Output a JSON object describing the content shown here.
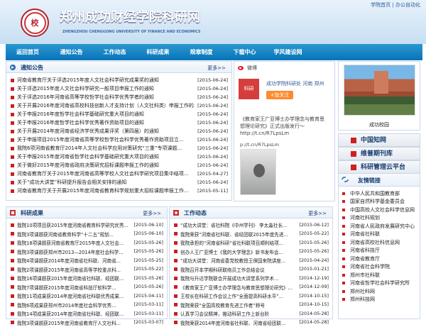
{
  "header": {
    "site_title": "郑州成功财经学院科研网",
    "site_subtitle": "ZHENGZHOU CHENGGONG UNIVERSITY OF FINANCE AND ECONOMICS",
    "top_links": [
      "学院首页",
      "|",
      "办公自动化"
    ]
  },
  "nav": [
    "返回首页",
    "通知公告",
    "工作动态",
    "科研成果",
    "规章制度",
    "下载中心",
    "学风建设网"
  ],
  "notice": {
    "title": "通知公告",
    "more": "更多>>",
    "items": [
      {
        "title": "河南省教育厅关于评选2015年度人文社会科学研究成果奖的通知",
        "date": "[2015-06-24]"
      },
      {
        "title": "关于评选2015年度人文社会科学研究一般项目申报工作的通知",
        "date": "[2015-06-24]"
      },
      {
        "title": "关于评选2016年河南省高等学校哲学社会科学优秀学者的通知",
        "date": "[2015-06-24]"
      },
      {
        "title": "关于开展2016年度河南省高校科技创新人才支持计划（人文社科类）申报工作的...",
        "date": "[2015-06-24]"
      },
      {
        "title": "关于申报2016年度哲学社会科学基础研究重大项目的通知",
        "date": "[2015-06-24]"
      },
      {
        "title": "关于申报2016年度哲学社会科学优秀著作资助项目的通知",
        "date": "[2015-06-24]"
      },
      {
        "title": "关于开展2014年度河南省经济学优秀成果评奖（第四届）的通知",
        "date": "[2015-06-24]"
      },
      {
        "title": "关于申报项目2015年度河南省高等学校哲学社会科学优秀著作资助项目立...",
        "date": "[2015-06-24]"
      },
      {
        "title": "我院6项河南省教育厅2014年人文社会科学应用对策研究“三重”专项课题...",
        "date": "[2015-06-24]"
      },
      {
        "title": "关于申报2015年度河南省哲学社会科学基础研究重大项目的通知",
        "date": "[2015-06-24]"
      },
      {
        "title": "关于做好2015年度河南省政府决策研究招标课题申报工作的通知",
        "date": "[2015-06-24]"
      },
      {
        "title": "河南省教育厅关于2015年度河南省高等学校人文社会科学研究项目集中结项...",
        "date": "[2015-04-27]"
      },
      {
        "title": "关于“成功大讲堂”科研提升报告会相关安排的通知",
        "date": "[2015-06-24]"
      },
      {
        "title": "河南省教育厅关于开展2015年度河南省教育科学规划重大招标课题申报工作...",
        "date": "[2015-05-11]"
      }
    ]
  },
  "weibo": {
    "title": "微博",
    "account": "成功学院科研处",
    "location": "河南 郑州",
    "follow": "+加关注",
    "message": "《教育家王广亚博士办学理念与教育思想理论研究》正式出版发行～http://t.cn/R7LpsLm",
    "url": "p://t.cn/R7LpsLm"
  },
  "campus": {
    "caption": "成功校园"
  },
  "quick_links": [
    "中国知网",
    "维普期刊库",
    "科研管理云平台"
  ],
  "achievements": {
    "title": "科研成果",
    "more": "更多>>",
    "items": [
      {
        "title": "我院10项项目获2015年度河南省教育科学研究优秀...",
        "date": "[2015-06-10]"
      },
      {
        "title": "我院3项课题获河南省教育科学“十二五”规划...",
        "date": "[2015-06-10]"
      },
      {
        "title": "我院18项课题获河南省教育厅2015年度人文社会...",
        "date": "[2015-05-26]"
      },
      {
        "title": "我院3项课题获郑州市2013—2014年度社会科学...",
        "date": "[2015-05-26]"
      },
      {
        "title": "我院4项课题获2014年度河南省社科联、河南省...",
        "date": "[2015-05-25]"
      },
      {
        "title": "我院2项课题获2015年度河南省高等学校重点科...",
        "date": "[2015-05-22]"
      },
      {
        "title": "我院16项课题获2015年度河南省社科联、经团联...",
        "date": "[2015-05-26]"
      },
      {
        "title": "我院7项课题获2015年度河南省科技厅软科学...",
        "date": "[2015-05-26]"
      },
      {
        "title": "我院11项成果获2014年度河南省社科联优秀成果...",
        "date": "[2015-04-11]"
      },
      {
        "title": "我院6项成果获郑州市2014年度社会科学优秀...",
        "date": "[2015-03-11]"
      },
      {
        "title": "我院14项成果获2014年度河南省社科联、经团联...",
        "date": "[2015-03-11]"
      },
      {
        "title": "我院3项课题获2015年度河南省教育厅人文社科...",
        "date": "[2015-03-07]"
      }
    ]
  },
  "activities": {
    "title": "工作动态",
    "more": "更多>>",
    "items": [
      {
        "title": "“成功大讲堂：省社科院《中州学刊》 李太淼社长...",
        "date": "[2015-06-12]"
      },
      {
        "title": "我院荣获“河南省社科联、省经团联2015年度先进...",
        "date": "[2015-05-22]"
      },
      {
        "title": "我院承担的“河南省科研”省社科联项目顺利结项...",
        "date": "[2015-05-26]"
      },
      {
        "title": "创办人王广亚博士《我的大学理念》新书发布会...",
        "date": "[2015-05-26]"
      },
      {
        "title": "“成功大讲堂：河南省委党校教授王保国来院讲座...",
        "date": "[2015-04-24]"
      },
      {
        "title": "我院召开本学期科研联络员工作总结会议",
        "date": "[2015-01-21]"
      },
      {
        "title": "我院与升达学院联合开展成功大讲堂系列学术...",
        "date": "[2014-12-19]"
      },
      {
        "title": "《教育家王广亚博士办学理念与教育思想理论研究》...",
        "date": "[2014-12-09]"
      },
      {
        "title": "王校长在科研工作会议上作“全面提高科研水平”...",
        "date": "[2014-10-15]"
      },
      {
        "title": "我院荣获“全国高校教育先进工作者”称号",
        "date": "[2014-10-15]"
      },
      {
        "title": "认真学习会议精神，推动科研工作上新台阶",
        "date": "[2014-05-28]"
      },
      {
        "title": "我院荣获2014年度河南省社科联、河南省经团联...",
        "date": "[2014-05-28]"
      }
    ]
  },
  "friend_links": {
    "title": "友情链接",
    "items": [
      "中华人民共和国教育部",
      "国家自然科学基金委员会",
      "中国高校人文社会科学信息网",
      "河南社科规划",
      "河南省人民政府发展研究中心",
      "河南省社科联",
      "河南省高校社科信息网",
      "河南省科技厅",
      "河南省教育厅",
      "河南省社会科学院",
      "郑州市社科联",
      "河南省哲学社会科学研究所",
      "郑州社科网",
      "郑州科技网"
    ]
  }
}
